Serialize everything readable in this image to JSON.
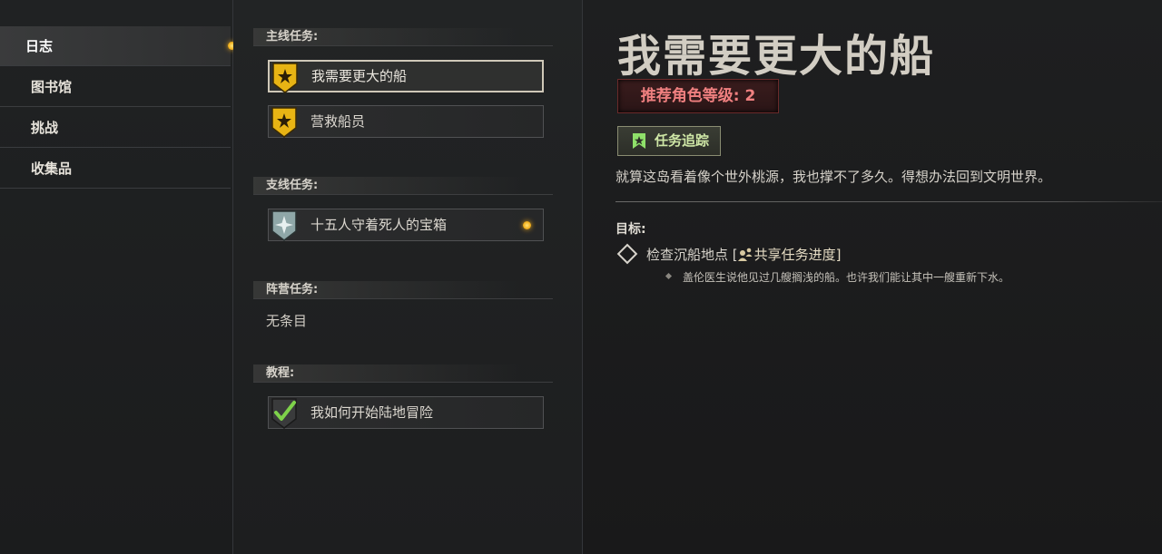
{
  "nav": {
    "items": [
      {
        "label": "日志",
        "active": true
      },
      {
        "label": "图书馆",
        "active": false
      },
      {
        "label": "挑战",
        "active": false
      },
      {
        "label": "收集品",
        "active": false
      }
    ]
  },
  "quests": {
    "main": {
      "header": "主线任务:",
      "items": [
        {
          "label": "我需要更大的船",
          "icon": "gold-star-shield-icon",
          "selected": true
        },
        {
          "label": "营救船员",
          "icon": "gold-star-shield-icon",
          "selected": false
        }
      ]
    },
    "side": {
      "header": "支线任务:",
      "items": [
        {
          "label": "十五人守着死人的宝箱",
          "icon": "silver-star-shield-icon",
          "new": true
        }
      ]
    },
    "faction": {
      "header": "阵营任务:",
      "empty": "无条目"
    },
    "tutorial": {
      "header": "教程:",
      "items": [
        {
          "label": "我如何开始陆地冒险",
          "icon": "checkmark-shield-icon",
          "completed": true
        }
      ]
    }
  },
  "detail": {
    "title": "我需要更大的船",
    "level_label": "推荐角色等级:",
    "level_value": "2",
    "track_label": "任务追踪",
    "description": "就算这岛看着像个世外桃源，我也撑不了多久。得想办法回到文明世界。",
    "objectives_header": "目标:",
    "objective": "检查沉船地点",
    "share_prefix": " [",
    "share_label": "共享任务进度",
    "share_suffix": "]",
    "sub_objective": "盖伦医生说他见过几艘搁浅的船。也许我们能让其中一艘重新下水。"
  },
  "colors": {
    "level_text": "#f08080",
    "track_text": "#cfe7a6",
    "new_dot": "#f2b01c",
    "gold_shield": "#e8b414"
  }
}
